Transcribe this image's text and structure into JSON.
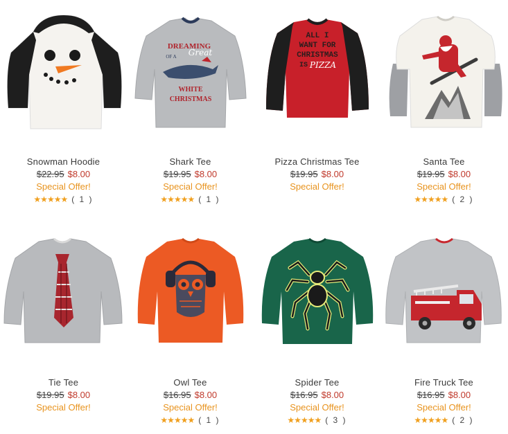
{
  "colors": {
    "price_sale": "#c0392b",
    "special_offer": "#e8931e",
    "stars": "#f0a020"
  },
  "products": [
    {
      "name": "Snowman Hoodie",
      "old_price": "$22.95",
      "price": "$8.00",
      "offer": "Special Offer!",
      "stars": "★★★★★",
      "reviews": "( 1 )"
    },
    {
      "name": "Shark Tee",
      "old_price": "$19.95",
      "price": "$8.00",
      "offer": "Special Offer!",
      "stars": "★★★★★",
      "reviews": "( 1 )",
      "art": {
        "line1": "DREAMING",
        "line2": "OF A",
        "script": "Great",
        "line3": "WHITE",
        "line4": "CHRISTMAS"
      }
    },
    {
      "name": "Pizza Christmas Tee",
      "old_price": "$19.95",
      "price": "$8.00",
      "offer": "Special Offer!",
      "art": {
        "line1": "ALL I",
        "line2": "WANT FOR",
        "line3": "CHRISTMAS",
        "line4": "IS",
        "script": "PIZZA"
      }
    },
    {
      "name": "Santa Tee",
      "old_price": "$19.95",
      "price": "$8.00",
      "offer": "Special Offer!",
      "stars": "★★★★★",
      "reviews": "( 2 )"
    },
    {
      "name": "Tie Tee",
      "old_price": "$19.95",
      "price": "$8.00",
      "offer": "Special Offer!"
    },
    {
      "name": "Owl Tee",
      "old_price": "$16.95",
      "price": "$8.00",
      "offer": "Special Offer!",
      "stars": "★★★★★",
      "reviews": "( 1 )"
    },
    {
      "name": "Spider Tee",
      "old_price": "$16.95",
      "price": "$8.00",
      "offer": "Special Offer!",
      "stars": "★★★★★",
      "reviews": "( 3 )"
    },
    {
      "name": "Fire Truck Tee",
      "old_price": "$16.95",
      "price": "$8.00",
      "offer": "Special Offer!",
      "stars": "★★★★★",
      "reviews": "( 2 )"
    }
  ]
}
